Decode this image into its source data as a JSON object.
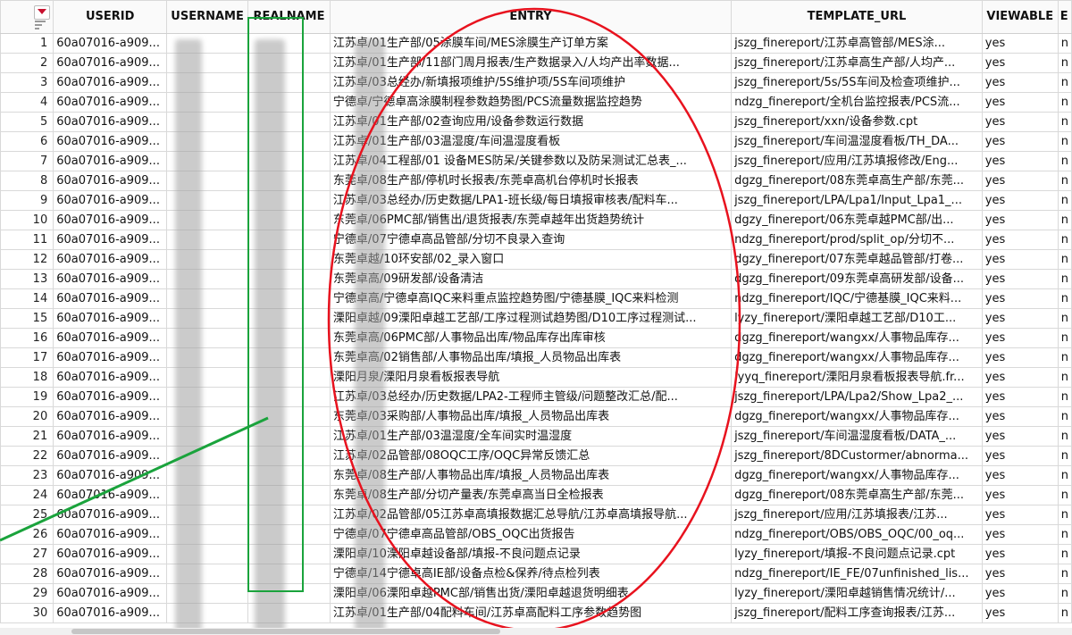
{
  "columns": [
    "USERID",
    "USERNAME",
    "REALNAME",
    "ENTRY",
    "TEMPLATE_URL",
    "VIEWABLE",
    "E"
  ],
  "rows": [
    {
      "n": "1",
      "userid": "60a07016-a909...",
      "entry": "江苏卓/01生产部/05涂膜车间/MES涂膜生产订单方案",
      "url": "jszg_finereport/江苏卓高管部/MES涂...",
      "viewable": "yes",
      "e": "n"
    },
    {
      "n": "2",
      "userid": "60a07016-a909...",
      "entry": "江苏卓/01生产部/11部门周月报表/生产数据录入/人均产出率数据...",
      "url": "jszg_finereport/江苏卓高生产部/人均产...",
      "viewable": "yes",
      "e": "n"
    },
    {
      "n": "3",
      "userid": "60a07016-a909...",
      "entry": "江苏卓/03总经办/新填报项维护/5S维护项/5S车间项维护",
      "url": "jszg_finereport/5s/5S车间及检查项维护...",
      "viewable": "yes",
      "e": "n"
    },
    {
      "n": "4",
      "userid": "60a07016-a909...",
      "entry": "宁德卓/宁德卓高涂膜制程参数趋势图/PCS流量数据监控趋势",
      "url": "ndzg_finereport/全机台监控报表/PCS流...",
      "viewable": "yes",
      "e": "n"
    },
    {
      "n": "5",
      "userid": "60a07016-a909...",
      "entry": "江苏卓/01生产部/02查询应用/设备参数运行数据",
      "url": "jszg_finereport/xxn/设备参数.cpt",
      "viewable": "yes",
      "e": "n"
    },
    {
      "n": "6",
      "userid": "60a07016-a909...",
      "entry": "江苏卓/01生产部/03温湿度/车间温湿度看板",
      "url": "jszg_finereport/车间温湿度看板/TH_DA...",
      "viewable": "yes",
      "e": "n"
    },
    {
      "n": "7",
      "userid": "60a07016-a909...",
      "entry": "江苏卓/04工程部/01 设备MES防呆/关键参数以及防呆测试汇总表_...",
      "url": "jszg_finereport/应用/江苏填报修改/Eng...",
      "viewable": "yes",
      "e": "n"
    },
    {
      "n": "8",
      "userid": "60a07016-a909...",
      "entry": "东莞卓/08生产部/停机时长报表/东莞卓高机台停机时长报表",
      "url": "dgzg_finereport/08东莞卓高生产部/东莞...",
      "viewable": "yes",
      "e": "n"
    },
    {
      "n": "9",
      "userid": "60a07016-a909...",
      "entry": "江苏卓/03总经办/历史数据/LPA1-班长级/每日填报审核表/配料车...",
      "url": "jszg_finereport/LPA/Lpa1/Input_Lpa1_...",
      "viewable": "yes",
      "e": "n"
    },
    {
      "n": "10",
      "userid": "60a07016-a909...",
      "entry": "东莞卓/06PMC部/销售出/退货报表/东莞卓越年出货趋势统计",
      "url": "dgzy_finereport/06东莞卓越PMC部/出...",
      "viewable": "yes",
      "e": "n"
    },
    {
      "n": "11",
      "userid": "60a07016-a909...",
      "entry": "宁德卓/07宁德卓高品管部/分切不良录入查询",
      "url": "ndzg_finereport/prod/split_op/分切不...",
      "viewable": "yes",
      "e": "n"
    },
    {
      "n": "12",
      "userid": "60a07016-a909...",
      "entry": "东莞卓越/10环安部/02_录入窗口",
      "url": "dgzy_finereport/07东莞卓越品管部/打卷...",
      "viewable": "yes",
      "e": "n"
    },
    {
      "n": "13",
      "userid": "60a07016-a909...",
      "entry": "东莞卓高/09研发部/设备清洁",
      "url": "dgzg_finereport/09东莞卓高研发部/设备...",
      "viewable": "yes",
      "e": "n"
    },
    {
      "n": "14",
      "userid": "60a07016-a909...",
      "entry": "宁德卓高/宁德卓高IQC来料重点监控趋势图/宁德基膜_IQC来料检测",
      "url": "ndzg_finereport/IQC/宁德基膜_IQC来料...",
      "viewable": "yes",
      "e": "n"
    },
    {
      "n": "15",
      "userid": "60a07016-a909...",
      "entry": "溧阳卓越/09溧阳卓越工艺部/工序过程测试趋势图/D10工序过程测试...",
      "url": "lyzy_finereport/溧阳卓越工艺部/D10工...",
      "viewable": "yes",
      "e": "n"
    },
    {
      "n": "16",
      "userid": "60a07016-a909...",
      "entry": "东莞卓高/06PMC部/人事物品出库/物品库存出库审核",
      "url": "dgzg_finereport/wangxx/人事物品库存...",
      "viewable": "yes",
      "e": "n"
    },
    {
      "n": "17",
      "userid": "60a07016-a909...",
      "entry": "东莞卓高/02销售部/人事物品出库/填报_人员物品出库表",
      "url": "dgzg_finereport/wangxx/人事物品库存...",
      "viewable": "yes",
      "e": "n"
    },
    {
      "n": "18",
      "userid": "60a07016-a909...",
      "entry": "溧阳月泉/溧阳月泉看板报表导航",
      "url": "lyyq_finereport/溧阳月泉看板报表导航.fr...",
      "viewable": "yes",
      "e": "n"
    },
    {
      "n": "19",
      "userid": "60a07016-a909...",
      "entry": "江苏卓/03总经办/历史数据/LPA2-工程师主管级/问题整改汇总/配...",
      "url": "jszg_finereport/LPA/Lpa2/Show_Lpa2_...",
      "viewable": "yes",
      "e": "n"
    },
    {
      "n": "20",
      "userid": "60a07016-a909...",
      "entry": "东莞卓/03采购部/人事物品出库/填报_人员物品出库表",
      "url": "dgzg_finereport/wangxx/人事物品库存...",
      "viewable": "yes",
      "e": "n"
    },
    {
      "n": "21",
      "userid": "60a07016-a909...",
      "entry": "江苏卓/01生产部/03温湿度/全车间实时温湿度",
      "url": "jszg_finereport/车间温湿度看板/DATA_...",
      "viewable": "yes",
      "e": "n"
    },
    {
      "n": "22",
      "userid": "60a07016-a909...",
      "entry": "江苏卓/02品管部/08OQC工序/OQC异常反馈汇总",
      "url": "jszg_finereport/8DCustormer/abnorma...",
      "viewable": "yes",
      "e": "n"
    },
    {
      "n": "23",
      "userid": "60a07016-a909...",
      "entry": "东莞卓/08生产部/人事物品出库/填报_人员物品出库表",
      "url": "dgzg_finereport/wangxx/人事物品库存...",
      "viewable": "yes",
      "e": "n"
    },
    {
      "n": "24",
      "userid": "60a07016-a909...",
      "entry": "东莞卓/08生产部/分切产量表/东莞卓高当日全检报表",
      "url": "dgzg_finereport/08东莞卓高生产部/东莞...",
      "viewable": "yes",
      "e": "n"
    },
    {
      "n": "25",
      "userid": "60a07016-a909...",
      "entry": "江苏卓/02品管部/05江苏卓高填报数据汇总导航/江苏卓高填报导航...",
      "url": "jszg_finereport/应用/江苏填报表/江苏...",
      "viewable": "yes",
      "e": "n"
    },
    {
      "n": "26",
      "userid": "60a07016-a909...",
      "entry": "宁德卓/07宁德卓高品管部/OBS_OQC出货报告",
      "url": "ndzg_finereport/OBS/OBS_OQC/00_oq...",
      "viewable": "yes",
      "e": "n"
    },
    {
      "n": "27",
      "userid": "60a07016-a909...",
      "entry": "溧阳卓/10溧阳卓越设备部/填报-不良问题点记录",
      "url": "lyzy_finereport/填报-不良问题点记录.cpt",
      "viewable": "yes",
      "e": "n"
    },
    {
      "n": "28",
      "userid": "60a07016-a909...",
      "entry": "宁德卓/14宁德卓高IE部/设备点检&保养/待点检列表",
      "url": "ndzg_finereport/IE_FE/07unfinished_lis...",
      "viewable": "yes",
      "e": "n"
    },
    {
      "n": "29",
      "userid": "60a07016-a909...",
      "entry": "溧阳卓/06溧阳卓越PMC部/销售出货/溧阳卓越退货明细表",
      "url": "lyzy_finereport/溧阳卓越销售情况统计/...",
      "viewable": "yes",
      "e": "n"
    },
    {
      "n": "30",
      "userid": "60a07016-a909...",
      "entry": "江苏卓/01生产部/04配料车间/江苏卓高配料工序参数趋势图",
      "url": "jszg_finereport/配料工序查询报表/江苏...",
      "viewable": "yes",
      "e": "n"
    }
  ],
  "colors": {
    "annotation_red": "#e8121e",
    "annotation_green": "#1aa33c",
    "grid_line": "#d9d9d9",
    "menu_triangle": "#c8102e"
  }
}
